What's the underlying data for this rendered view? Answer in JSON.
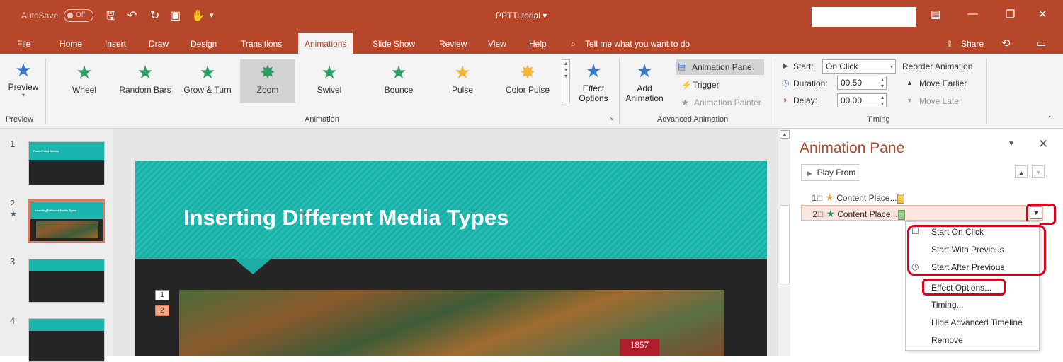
{
  "titlebar": {
    "autosave_label": "AutoSave",
    "autosave_state": "Off",
    "doc_title": "PPTTutorial ▾"
  },
  "tabs": [
    "File",
    "Home",
    "Insert",
    "Draw",
    "Design",
    "Transitions",
    "Animations",
    "Slide Show",
    "Review",
    "View",
    "Help"
  ],
  "active_tab": "Animations",
  "tell_me": "Tell me what you want to do",
  "share_label": "Share",
  "ribbon": {
    "preview_label": "Preview",
    "preview_group": "Preview",
    "animation_group": "Animation",
    "gallery": [
      "Wheel",
      "Random Bars",
      "Grow & Turn",
      "Zoom",
      "Swivel",
      "Bounce",
      "Pulse",
      "Color Pulse"
    ],
    "selected_effect": "Zoom",
    "effect_options_1": "Effect",
    "effect_options_2": "Options",
    "add_animation_1": "Add",
    "add_animation_2": "Animation",
    "animation_pane_btn": "Animation Pane",
    "trigger_btn": "Trigger",
    "animation_painter_btn": "Animation Painter",
    "advanced_group": "Advanced Animation",
    "start_label": "Start:",
    "start_value": "On Click",
    "duration_label": "Duration:",
    "duration_value": "00.50",
    "delay_label": "Delay:",
    "delay_value": "00.00",
    "timing_group": "Timing",
    "reorder_label": "Reorder Animation",
    "move_earlier": "Move Earlier",
    "move_later": "Move Later"
  },
  "thumbnails": [
    {
      "num": "1",
      "title": "PowerPoint Basics"
    },
    {
      "num": "2",
      "title": "Inserting Different Media Types"
    },
    {
      "num": "3",
      "title": ""
    },
    {
      "num": "4",
      "title": ""
    }
  ],
  "active_slide_marker": "★",
  "slide": {
    "title": "Inserting Different Media Types",
    "anim_tags": [
      "1",
      "2"
    ],
    "seal_text": "1857"
  },
  "pane": {
    "title": "Animation Pane",
    "play_from": "Play From",
    "rows": [
      {
        "num": "1",
        "label": "Content Place...",
        "color": "#f2c84b"
      },
      {
        "num": "2",
        "label": "Content Place...",
        "color": "#8fd17b"
      }
    ]
  },
  "context_menu": {
    "items": [
      "Start On Click",
      "Start With Previous",
      "Start After Previous",
      "Effect Options...",
      "Timing...",
      "Hide Advanced Timeline",
      "Remove"
    ]
  },
  "colors": {
    "accent": "#b7472a",
    "highlight_red": "#e0001b",
    "slide_teal": "#1ab5ac"
  }
}
